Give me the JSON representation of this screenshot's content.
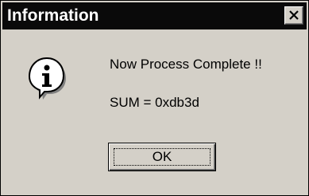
{
  "dialog": {
    "title": "Information",
    "close_icon": "close-icon",
    "icon": "information-icon",
    "icon_glyph": "i",
    "message": "Now Process Complete !!",
    "sum_text": "SUM = 0xdb3d",
    "ok_label": "OK"
  },
  "colors": {
    "titlebar": "#0a0a0a",
    "title_text": "#ffffff",
    "dialog_bg": "#d4d0c8"
  }
}
